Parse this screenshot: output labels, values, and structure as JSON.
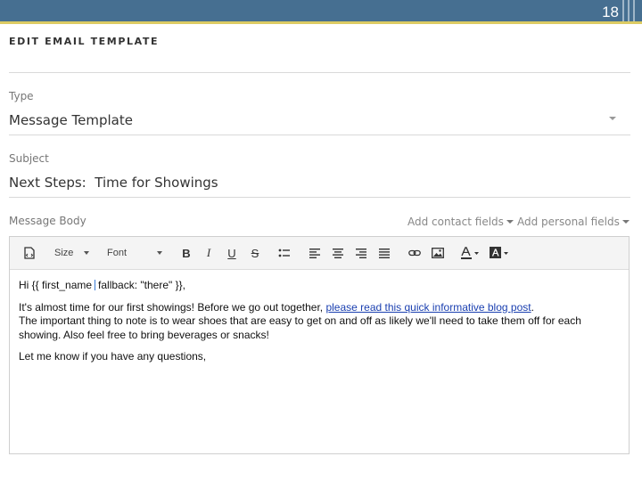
{
  "slide_number": "18",
  "page": {
    "heading": "EDIT EMAIL TEMPLATE"
  },
  "type_field": {
    "label": "Type",
    "value": "Message Template"
  },
  "subject_field": {
    "label": "Subject",
    "value": "Next Steps:  Time for Showings"
  },
  "message_body": {
    "label": "Message Body",
    "add_contact_fields": "Add contact fields",
    "add_personal_fields": "Add personal fields"
  },
  "toolbar": {
    "size_label": "Size",
    "font_label": "Font",
    "bold": "B",
    "italic": "I",
    "underline": "U",
    "strikethrough": "S"
  },
  "email_body": {
    "greeting_start": "Hi {{ first_name",
    "greeting_end": "fallback: \"there\" }},",
    "para1_text": "It's almost time for our first showings! Before we go out together, ",
    "para1_link": "please read this quick informative blog post",
    "para1_end": ".",
    "para2_line1": "The important thing to note is to wear shoes that are easy to get on and off as likely we'll need to take them off for each",
    "para2_line2": "showing. Also feel free to bring beverages or snacks!",
    "closing": "Let me know if you have any questions,"
  },
  "colors": {
    "header_bar": "#466f91",
    "header_accent": "#dccb63",
    "link": "#1a3fb0"
  }
}
